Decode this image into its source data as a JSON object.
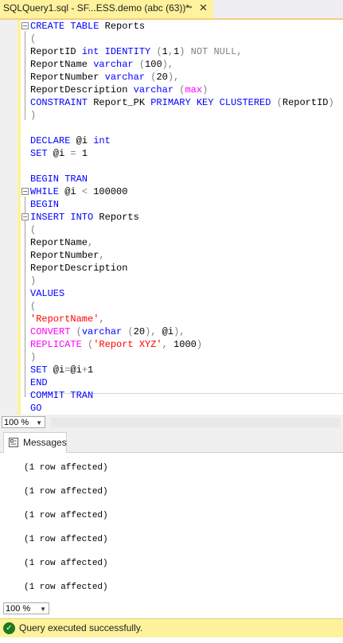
{
  "tab": {
    "title": "SQLQuery1.sql - SF...ESS.demo (abc (63))*",
    "pin_glyph": "⊸",
    "close_glyph": "✕"
  },
  "editor": {
    "lines": [
      [
        [
          "kw",
          "CREATE TABLE"
        ],
        [
          "t",
          " Reports"
        ]
      ],
      [
        [
          "gray",
          "("
        ]
      ],
      [
        [
          "t",
          "ReportID "
        ],
        [
          "kw",
          "int IDENTITY"
        ],
        [
          "t",
          " "
        ],
        [
          "gray",
          "("
        ],
        [
          "t",
          "1"
        ],
        [
          "gray",
          ","
        ],
        [
          "t",
          "1"
        ],
        [
          "gray",
          ")"
        ],
        [
          "t",
          " "
        ],
        [
          "gray",
          "NOT NULL,"
        ]
      ],
      [
        [
          "t",
          "ReportName "
        ],
        [
          "kw",
          "varchar"
        ],
        [
          "t",
          " "
        ],
        [
          "gray",
          "("
        ],
        [
          "t",
          "100"
        ],
        [
          "gray",
          "),"
        ]
      ],
      [
        [
          "t",
          "ReportNumber "
        ],
        [
          "kw",
          "varchar"
        ],
        [
          "t",
          " "
        ],
        [
          "gray",
          "("
        ],
        [
          "t",
          "20"
        ],
        [
          "gray",
          "),"
        ]
      ],
      [
        [
          "t",
          "ReportDescription "
        ],
        [
          "kw",
          "varchar"
        ],
        [
          "t",
          " "
        ],
        [
          "gray",
          "("
        ],
        [
          "fn",
          "max"
        ],
        [
          "gray",
          ")"
        ]
      ],
      [
        [
          "kw",
          "CONSTRAINT"
        ],
        [
          "t",
          " Report_PK "
        ],
        [
          "kw",
          "PRIMARY KEY CLUSTERED"
        ],
        [
          "t",
          " "
        ],
        [
          "gray",
          "("
        ],
        [
          "t",
          "ReportID"
        ],
        [
          "gray",
          ")"
        ]
      ],
      [
        [
          "gray",
          ")"
        ]
      ],
      [],
      [
        [
          "kw",
          "DECLARE"
        ],
        [
          "t",
          " @i "
        ],
        [
          "kw",
          "int"
        ]
      ],
      [
        [
          "kw",
          "SET"
        ],
        [
          "t",
          " @i "
        ],
        [
          "gray",
          "="
        ],
        [
          "t",
          " 1"
        ]
      ],
      [],
      [
        [
          "kw",
          "BEGIN TRAN"
        ]
      ],
      [
        [
          "kw",
          "WHILE"
        ],
        [
          "t",
          " @i "
        ],
        [
          "gray",
          "<"
        ],
        [
          "t",
          " 100000"
        ]
      ],
      [
        [
          "kw",
          "BEGIN"
        ]
      ],
      [
        [
          "kw",
          "INSERT INTO"
        ],
        [
          "t",
          " Reports"
        ]
      ],
      [
        [
          "gray",
          "("
        ]
      ],
      [
        [
          "t",
          "ReportName"
        ],
        [
          "gray",
          ","
        ]
      ],
      [
        [
          "t",
          "ReportNumber"
        ],
        [
          "gray",
          ","
        ]
      ],
      [
        [
          "t",
          "ReportDescription"
        ]
      ],
      [
        [
          "gray",
          ")"
        ]
      ],
      [
        [
          "kw",
          "VALUES"
        ]
      ],
      [
        [
          "gray",
          "("
        ]
      ],
      [
        [
          "str",
          "'ReportName'"
        ],
        [
          "gray",
          ","
        ]
      ],
      [
        [
          "fn",
          "CONVERT"
        ],
        [
          "t",
          " "
        ],
        [
          "gray",
          "("
        ],
        [
          "kw",
          "varchar"
        ],
        [
          "t",
          " "
        ],
        [
          "gray",
          "("
        ],
        [
          "t",
          "20"
        ],
        [
          "gray",
          "),"
        ],
        [
          "t",
          " @i"
        ],
        [
          "gray",
          "),"
        ]
      ],
      [
        [
          "fn",
          "REPLICATE"
        ],
        [
          "t",
          " "
        ],
        [
          "gray",
          "("
        ],
        [
          "str",
          "'Report XYZ'"
        ],
        [
          "gray",
          ","
        ],
        [
          "t",
          " 1000"
        ],
        [
          "gray",
          ")"
        ]
      ],
      [
        [
          "gray",
          ")"
        ]
      ],
      [
        [
          "kw",
          "SET"
        ],
        [
          "t",
          " @i"
        ],
        [
          "gray",
          "="
        ],
        [
          "t",
          "@i"
        ],
        [
          "gray",
          "+"
        ],
        [
          "t",
          "1"
        ]
      ],
      [
        [
          "kw",
          "END"
        ]
      ],
      [
        [
          "kw",
          "COMMIT TRAN"
        ]
      ],
      [
        [
          "kw",
          "GO"
        ]
      ]
    ]
  },
  "zoom_editor": {
    "value": "100 %"
  },
  "results": {
    "tab_label": "Messages",
    "messages": [
      "(1 row affected)",
      "(1 row affected)",
      "(1 row affected)",
      "(1 row affected)",
      "(1 row affected)",
      "(1 row affected)"
    ]
  },
  "zoom_results": {
    "value": "100 %"
  },
  "status": {
    "text": "Query executed successfully."
  },
  "colors": {
    "keyword": "#0000ff",
    "operator": "#808080",
    "function": "#ff00ff",
    "string": "#ff0000",
    "tab_active": "#fff29d",
    "status_bar": "#fff29d"
  },
  "icons": {
    "fold": "collapse-icon",
    "messages": "messages-icon",
    "success": "check-circle-icon"
  }
}
